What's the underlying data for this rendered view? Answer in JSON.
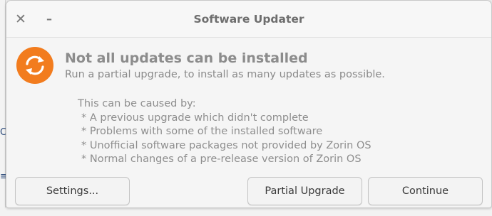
{
  "window": {
    "title": "Software Updater",
    "close_glyph": "✕",
    "minimize_glyph": "–"
  },
  "message": {
    "icon": "update-sync-icon",
    "icon_color": "#f27c1e",
    "heading": "Not all updates can be installed",
    "subheading": "Run a partial upgrade, to install as many updates as possible."
  },
  "details": {
    "intro": "This can be caused by:",
    "items": [
      "* A previous upgrade which didn't complete",
      "* Problems with some of the installed software",
      "* Unofficial software packages not provided by Zorin OS",
      "* Normal changes of a pre-release version of Zorin OS"
    ]
  },
  "buttons": {
    "settings": "Settings...",
    "partial_upgrade": "Partial Upgrade",
    "continue": "Continue"
  }
}
